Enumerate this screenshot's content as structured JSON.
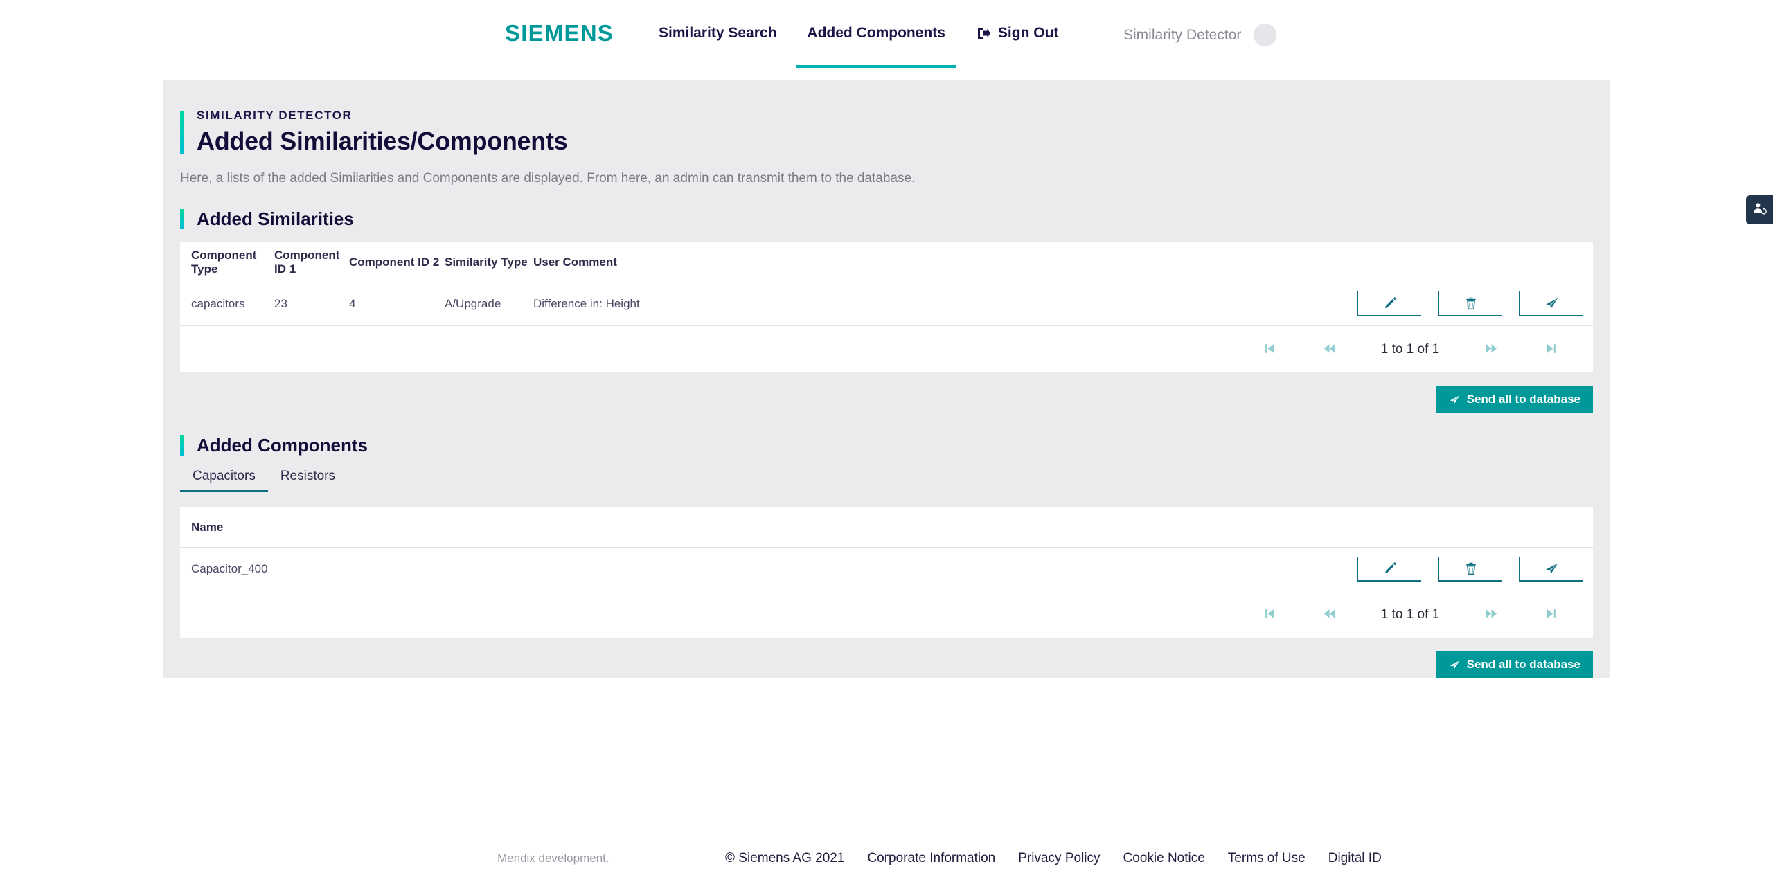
{
  "brand": {
    "logo_text": "SIEMENS"
  },
  "nav": {
    "items": [
      {
        "label": "Similarity Search",
        "active": false
      },
      {
        "label": "Added Components",
        "active": true
      },
      {
        "label": "Sign Out",
        "active": false,
        "icon": "sign-out-icon"
      }
    ]
  },
  "user": {
    "name": "Similarity Detector"
  },
  "side_tab": {
    "icon": "user-sync-icon"
  },
  "page": {
    "eyebrow": "SIMILARITY DETECTOR",
    "title": "Added Similarities/Components",
    "intro": "Here, a lists of the added Similarities and Components are displayed. From here, an admin can transmit them to the database."
  },
  "similarities": {
    "section_title": "Added Similarities",
    "columns": [
      "Component Type",
      "Component ID 1",
      "Component ID 2",
      "Similarity Type",
      "User Comment"
    ],
    "rows": [
      {
        "component_type": "capacitors",
        "component_id_1": "23",
        "component_id_2": "4",
        "similarity_type": "A/Upgrade",
        "user_comment": "Difference in: Height"
      }
    ],
    "actions": [
      {
        "name": "edit-row-button",
        "icon": "pencil-icon"
      },
      {
        "name": "delete-row-button",
        "icon": "trash-icon"
      },
      {
        "name": "send-row-button",
        "icon": "paper-plane-icon"
      }
    ],
    "pagination": {
      "first_label": "first-page",
      "prev_label": "previous-page",
      "status": "1 to 1 of 1",
      "next_label": "next-page",
      "last_label": "last-page"
    },
    "send_all_label": "Send all to database"
  },
  "components": {
    "section_title": "Added Components",
    "tabs": [
      {
        "label": "Capacitors",
        "active": true
      },
      {
        "label": "Resistors",
        "active": false
      }
    ],
    "columns": [
      "Name"
    ],
    "rows": [
      {
        "name": "Capacitor_400"
      }
    ],
    "actions": [
      {
        "name": "edit-row-button",
        "icon": "pencil-icon"
      },
      {
        "name": "delete-row-button",
        "icon": "trash-icon"
      },
      {
        "name": "send-row-button",
        "icon": "paper-plane-icon"
      }
    ],
    "pagination": {
      "status": "1 to 1 of 1"
    },
    "send_all_label": "Send all to database"
  },
  "footer": {
    "mendix": "Mendix development.",
    "copyright": "© Siemens AG 2021",
    "links": [
      "Corporate Information",
      "Privacy Policy",
      "Cookie Notice",
      "Terms of Use",
      "Digital ID"
    ]
  },
  "colors": {
    "brand_teal": "#009999",
    "accent_cyan": "#00b3b3",
    "accent_gradient_start": "#00d7a0",
    "accent_gradient_end": "#00bcd4",
    "icon_teal": "#0f7080",
    "pager_teal": "#8fcdd0",
    "panel_gray": "#ebebed",
    "text_navy": "#120c38",
    "side_tab_navy": "#23354b"
  }
}
